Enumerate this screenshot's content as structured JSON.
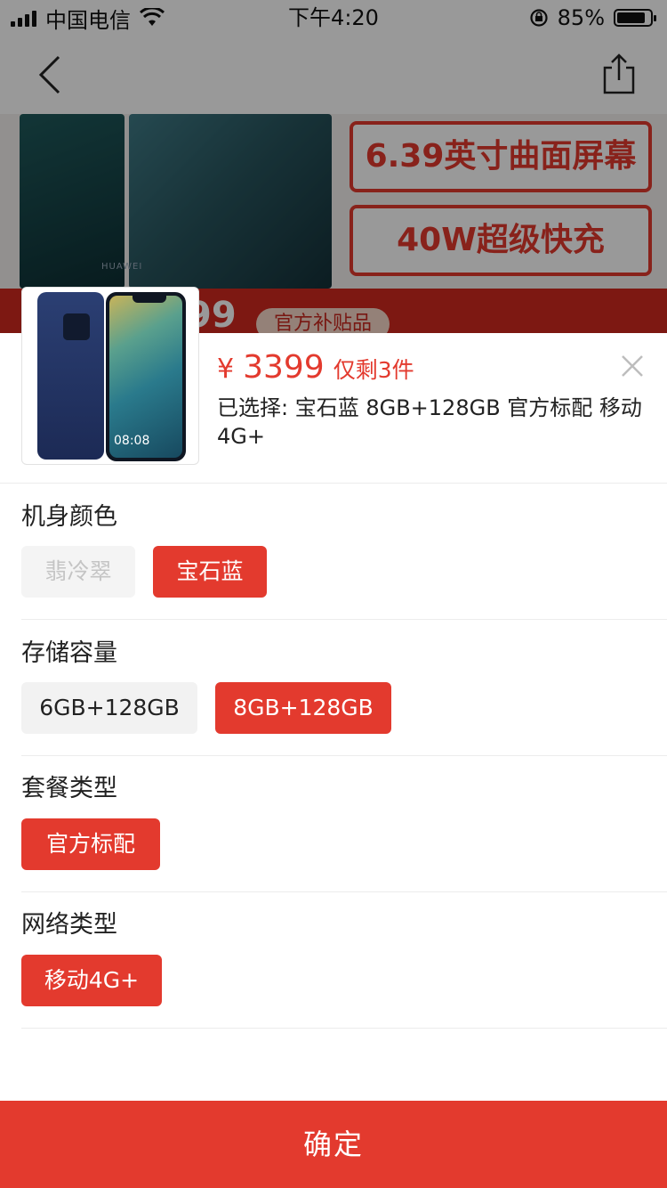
{
  "status_bar": {
    "carrier": "中国电信",
    "time": "下午4:20",
    "battery": "85%",
    "battery_level": 0.85
  },
  "background": {
    "hero_brand": "HUAWEI",
    "feature_1": "6.39英寸曲面屏幕",
    "feature_2": "40W超级快充",
    "strip_price": "99",
    "strip_badge": "官方补贴品"
  },
  "product": {
    "currency": "¥",
    "price": "3399",
    "stock": "仅剩3件",
    "selected_text": "已选择: 宝石蓝 8GB+128GB 官方标配 移动4G+",
    "phone_time": "08:08"
  },
  "groups": [
    {
      "title": "机身颜色",
      "options": [
        {
          "label": "翡冷翠",
          "state": "disabled"
        },
        {
          "label": "宝石蓝",
          "state": "selected"
        }
      ]
    },
    {
      "title": "存储容量",
      "options": [
        {
          "label": "6GB+128GB",
          "state": "normal"
        },
        {
          "label": "8GB+128GB",
          "state": "selected"
        }
      ]
    },
    {
      "title": "套餐类型",
      "options": [
        {
          "label": "官方标配",
          "state": "selected"
        }
      ]
    },
    {
      "title": "网络类型",
      "options": [
        {
          "label": "移动4G+",
          "state": "selected"
        }
      ]
    }
  ],
  "confirm_label": "确定",
  "icons": {
    "back": "back-chevron-icon",
    "share": "share-icon",
    "close": "close-icon",
    "wifi": "wifi-icon",
    "signal": "signal-icon",
    "lock": "rotation-lock-icon"
  },
  "colors": {
    "accent": "#e33a2e",
    "option_bg": "#f2f2f2",
    "disabled_text": "#c4c4c4"
  }
}
